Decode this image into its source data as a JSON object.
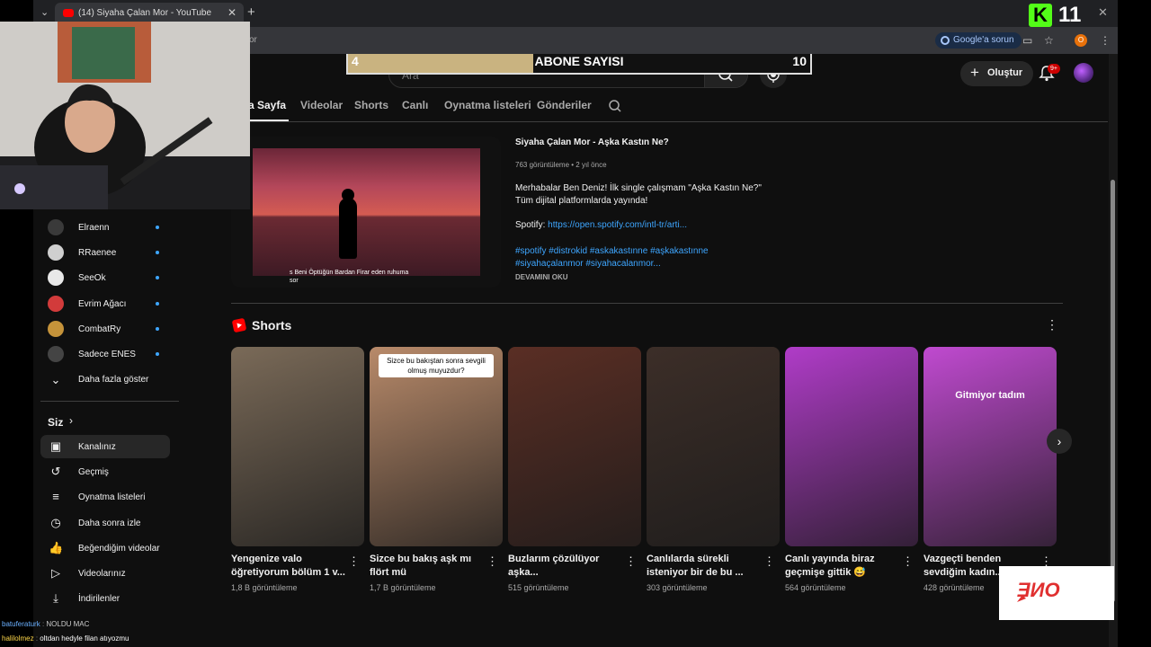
{
  "browser": {
    "tab_title": "(14) Siyaha Çalan Mor - YouTube",
    "url_fragment": "or",
    "google_button": "Google'a sorun",
    "profile_initial": "O",
    "new_tab_icon": "plus-icon",
    "brand_color": "#53fc18"
  },
  "kick": {
    "logo_letter": "K",
    "viewer_count": "11"
  },
  "abone": {
    "title": "ABONE SAYISI",
    "min": "4",
    "max": "10",
    "fill_fraction": 0.4
  },
  "youtube": {
    "search_placeholder": "Ara",
    "create_label": "Oluştur",
    "notifications_badge": "9+",
    "accent": "#3ea6ff",
    "tabs": [
      "a Sayfa",
      "Videolar",
      "Shorts",
      "Canlı",
      "Oynatma listeleri",
      "Gönderiler"
    ]
  },
  "sidebar": {
    "subscriptions": [
      {
        "name": "Elraenn",
        "color": "#3a3a3a"
      },
      {
        "name": "RRaenee",
        "color": "#cfcfcf"
      },
      {
        "name": "SeeOk",
        "color": "#e8e8e8"
      },
      {
        "name": "Evrim Ağacı",
        "color": "#d23b3b"
      },
      {
        "name": "CombatRy",
        "color": "#c5933a"
      },
      {
        "name": "Sadece ENES",
        "color": "#444444"
      }
    ],
    "show_more": "Daha fazla göster",
    "you_header": "Siz",
    "you_items": [
      {
        "label": "Kanalınız",
        "icon": "account-box-icon",
        "glyph": "▣"
      },
      {
        "label": "Geçmiş",
        "icon": "history-icon",
        "glyph": "↺"
      },
      {
        "label": "Oynatma listeleri",
        "icon": "playlist-icon",
        "glyph": "≡"
      },
      {
        "label": "Daha sonra izle",
        "icon": "clock-icon",
        "glyph": "◷"
      },
      {
        "label": "Beğendiğim videolar",
        "icon": "thumbs-up-icon",
        "glyph": "👍"
      },
      {
        "label": "Videolarınız",
        "icon": "video-icon",
        "glyph": "▷"
      },
      {
        "label": "İndirilenler",
        "icon": "download-icon",
        "glyph": "⤓"
      }
    ]
  },
  "featured": {
    "title": "Siyaha Çalan Mor - Aşka Kastın Ne?",
    "meta": "763 görüntüleme • 2 yıl önce",
    "desc_line1": "Merhabalar Ben Deniz! İlk single çalışmam \"Aşka Kastın Ne?\"",
    "desc_line2": "Tüm dijital platformlarda yayında!",
    "spotify_label": "Spotify: ",
    "spotify_link": "https://open.spotify.com/intl-tr/arti...",
    "tags_line1": "#spotify #distrokid #askakastınne #aşkakastınne",
    "tags_line2": "#siyahaçalanmor #siyahacalanmor...",
    "more": "DEVAMINI OKU",
    "lyric_line1": "s Beni Öptüğün Bardan Firar eden ruhuma",
    "lyric_line2": "sor"
  },
  "shorts": {
    "title": "Shorts",
    "items": [
      {
        "title": "Yengenize valo öğretiyorum bölüm 1 v...",
        "views": "1,8 B görüntüleme",
        "bg": "#7a6a58",
        "caption": "",
        "big": ""
      },
      {
        "title": "Sizce bu bakış aşk mı flört mü",
        "views": "1,7 B görüntüleme",
        "bg": "#b88a6a",
        "caption": "Sizce bu bakıştan sonra sevgili olmuş muyuzdur?",
        "big": ""
      },
      {
        "title": "Buzlarım çözülüyor aşka...",
        "views": "515 görüntüleme",
        "bg": "#5a2e24",
        "caption": "",
        "big": ""
      },
      {
        "title": "Canlılarda sürekli isteniyor bir de bu ...",
        "views": "303 görüntüleme",
        "bg": "#3c2e28",
        "caption": "",
        "big": ""
      },
      {
        "title": "Canlı yayında biraz geçmişe gittik 😅",
        "views": "564 görüntüleme",
        "bg": "#b03cc8",
        "caption": "",
        "big": ""
      },
      {
        "title": "Vazgeçti benden sevdiğim kadın...",
        "views": "428 görüntüleme",
        "bg": "#c04ad0",
        "caption": "",
        "big": "Gitmiyor tadım"
      }
    ]
  },
  "chat": [
    {
      "user": "batuferaturk",
      "text": "NOLDU MAC",
      "color": "#6ab0ff"
    },
    {
      "user": "halilolmez",
      "text": "oltdan hedyle filan atıyozmu",
      "color": "#ffd84a"
    }
  ]
}
